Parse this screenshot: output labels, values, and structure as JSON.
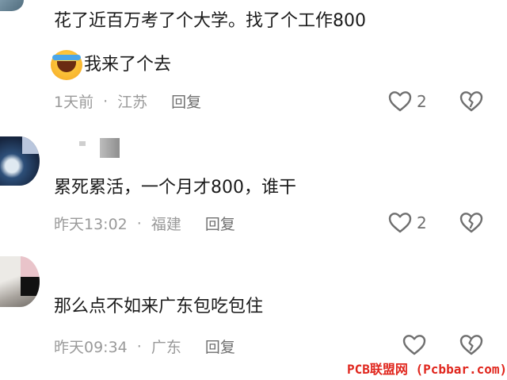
{
  "comments": [
    {
      "lines": [
        "花了近百万考了个大学。找了个工作800",
        "我来了个去"
      ],
      "emoji": "laughing-tears-emoji",
      "time": "1天前",
      "location": "江苏",
      "reply": "回复",
      "likes": "2"
    },
    {
      "lines": [
        "累死累活，一个月才800，谁干"
      ],
      "time": "昨天13:02",
      "location": "福建",
      "reply": "回复",
      "likes": "2"
    },
    {
      "lines": [
        "那么点不如来广东包吃包住"
      ],
      "time": "昨天09:34",
      "location": "广东",
      "reply": "回复",
      "likes": ""
    }
  ],
  "separator": "·",
  "watermark": "PCB联盟网 (Pcbbar.com)",
  "colors": {
    "meta": "#9a9a9a",
    "icon": "#6f6f6f",
    "watermark": "#e0261d"
  }
}
